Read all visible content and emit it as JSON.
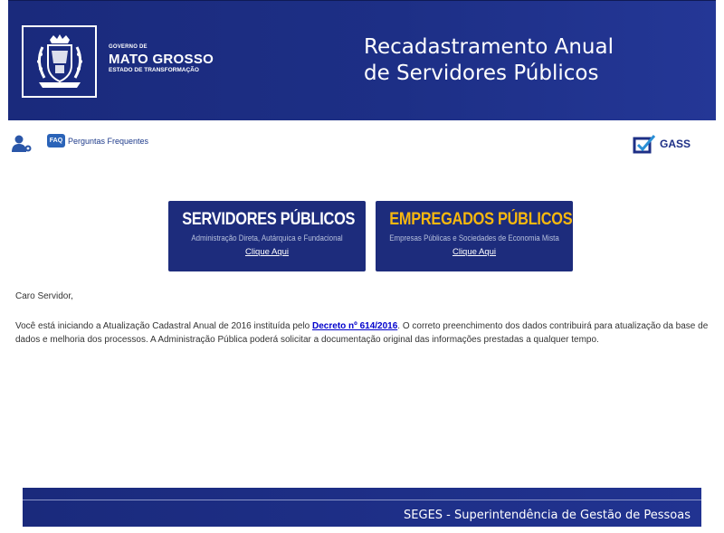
{
  "header": {
    "gov_small": "GOVERNO DE",
    "gov_big": "MATO GROSSO",
    "gov_sub": "ESTADO DE TRANSFORMAÇÃO",
    "title_line1": "Recadastramento Anual",
    "title_line2": "de Servidores Públicos"
  },
  "toolbar": {
    "user_icon": "user-settings-icon",
    "faq_badge": "FAQ",
    "faq_label": "Perguntas Frequentes",
    "gass_label": "GASS"
  },
  "cards": [
    {
      "title": "SERVIDORES PÚBLICOS",
      "subtitle": "Administração Direta, Autárquica e Fundacional",
      "link": "Clique Aqui",
      "title_color": "#ffffff"
    },
    {
      "title": "EMPREGADOS PÚBLICOS",
      "subtitle": "Empresas Públicas e Sociedades de Economia Mista",
      "link": "Clique Aqui",
      "title_color": "#f7b80f"
    }
  ],
  "content": {
    "greeting": "Caro Servidor,",
    "para_before": "Você está iniciando a Atualização Cadastral Anual de 2016 instituída pelo ",
    "decree_link": "Decreto nº 614/2016",
    "para_after": ". O correto preenchimento dos dados contribuirá para atualização da base de dados e melhoria dos processos. A Administração Pública poderá solicitar a documentação original das informações prestadas a qualquer tempo."
  },
  "footer": {
    "text": "SEGES - Superintendência de Gestão de Pessoas"
  },
  "colors": {
    "brand_blue": "#1d2c7c",
    "accent_yellow": "#f7b80f",
    "link_blue": "#0000cc"
  }
}
